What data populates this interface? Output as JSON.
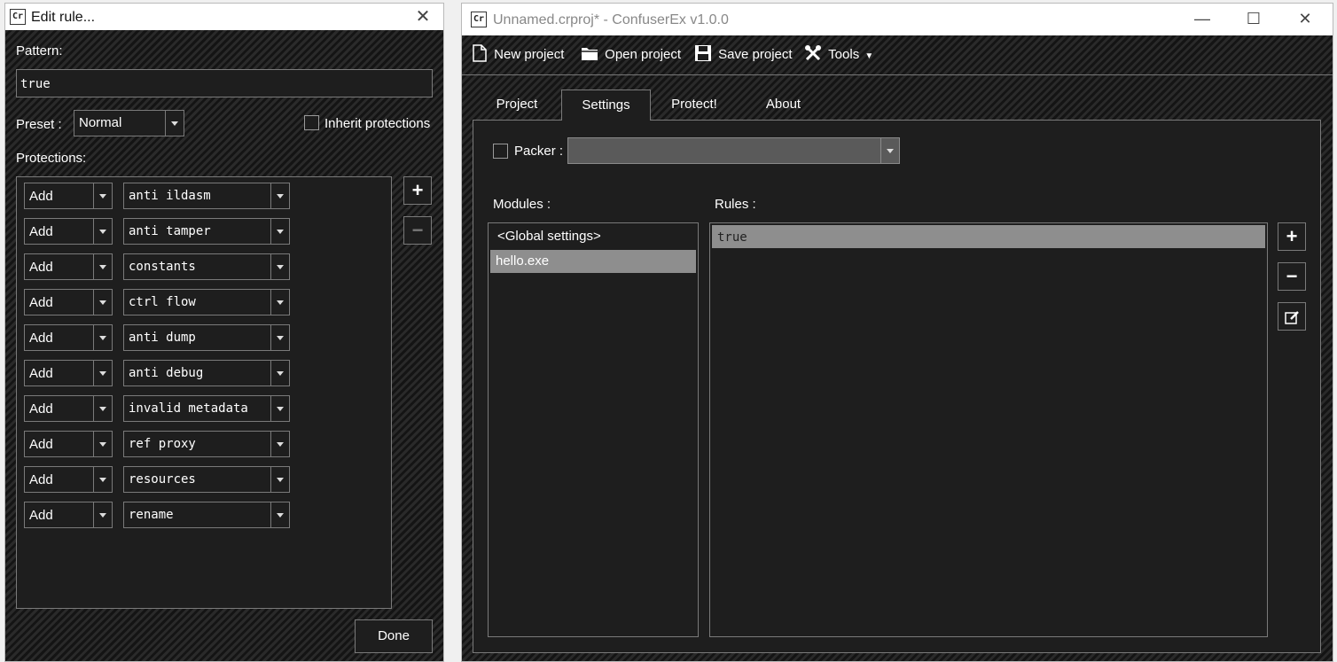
{
  "edit_dialog": {
    "title": "Edit rule...",
    "pattern_label": "Pattern:",
    "pattern_value": "true",
    "preset_label": "Preset :",
    "preset_value": "Normal",
    "inherit_label": "Inherit protections",
    "protections_label": "Protections:",
    "protections": [
      {
        "action": "Add",
        "name": "anti ildasm"
      },
      {
        "action": "Add",
        "name": "anti tamper"
      },
      {
        "action": "Add",
        "name": "constants"
      },
      {
        "action": "Add",
        "name": "ctrl flow"
      },
      {
        "action": "Add",
        "name": "anti dump"
      },
      {
        "action": "Add",
        "name": "anti debug"
      },
      {
        "action": "Add",
        "name": "invalid metadata"
      },
      {
        "action": "Add",
        "name": "ref proxy"
      },
      {
        "action": "Add",
        "name": "resources"
      },
      {
        "action": "Add",
        "name": "rename"
      }
    ],
    "done_label": "Done",
    "add_icon": "plus-icon",
    "remove_icon": "minus-icon"
  },
  "main_window": {
    "title": "Unnamed.crproj* - ConfuserEx v1.0.0",
    "toolbar": {
      "new_project": "New project",
      "open_project": "Open project",
      "save_project": "Save project",
      "tools": "Tools"
    },
    "tabs": [
      "Project",
      "Settings",
      "Protect!",
      "About"
    ],
    "active_tab": "Settings",
    "packer_label": "Packer :",
    "modules_label": "Modules :",
    "rules_label": "Rules :",
    "modules": [
      "<Global settings>",
      "hello.exe"
    ],
    "selected_module": "hello.exe",
    "rules": [
      "true"
    ]
  },
  "colors": {
    "panel_bg": "#1e1e1e",
    "border": "#7a7a7a",
    "selection": "#8e8e8e"
  }
}
